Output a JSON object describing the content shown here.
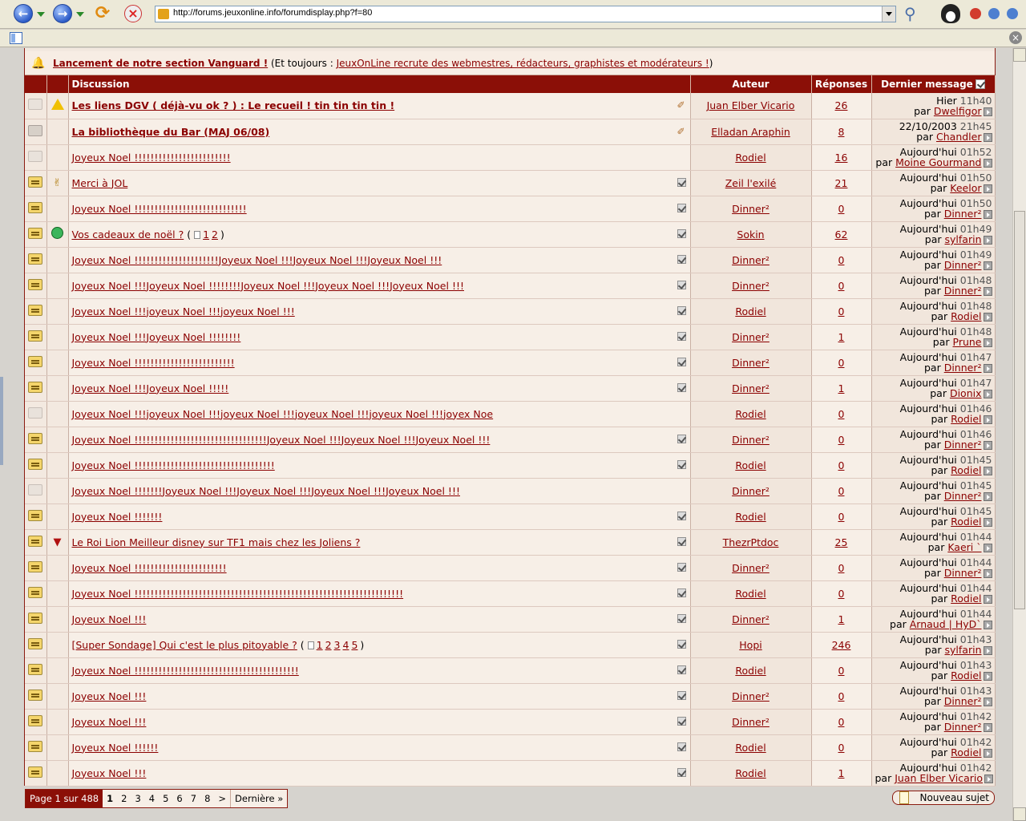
{
  "browser": {
    "url": "http://forums.jeuxonline.info/forumdisplay.php?f=80"
  },
  "announcement": {
    "title": "Lancement de notre section Vanguard !",
    "middle": "(Et toujours : ",
    "link": "JeuxOnLine recrute des webmestres, rédacteurs, graphistes et modérateurs !",
    "end": ")"
  },
  "headers": {
    "discussion": "Discussion",
    "author": "Auteur",
    "replies": "Réponses",
    "last": "Dernier message"
  },
  "threads": [
    {
      "status": "old",
      "icon": "warning-icon",
      "title": "Les liens DGV ( déjà-vu ok ? ) : Le recueil ! tin tin tin tin !",
      "bold": true,
      "mark": "pin",
      "author": "Juan Elber Vicario",
      "replies": "26",
      "last_day": "Hier",
      "last_time": "11h40",
      "last_by": "Dwelfigor"
    },
    {
      "status": "lock",
      "icon": "",
      "title": "La bibliothèque du Bar (MAJ 06/08)",
      "bold": true,
      "mark": "pin",
      "author": "Elladan Araphin",
      "replies": "8",
      "last_day": "22/10/2003",
      "last_time": "21h45",
      "last_by": "Chandler"
    },
    {
      "status": "old",
      "icon": "",
      "title": "Joyeux Noel !!!!!!!!!!!!!!!!!!!!!!!!",
      "bold": false,
      "mark": "",
      "author": "Rodiel",
      "replies": "16",
      "last_day": "Aujourd'hui",
      "last_time": "01h52",
      "last_by": "Moine Gourmand"
    },
    {
      "status": "new",
      "icon": "thumbs-up-icon",
      "title": "Merci à JOL",
      "bold": false,
      "mark": "check",
      "author": "Zeil l'exilé",
      "replies": "21",
      "last_day": "Aujourd'hui",
      "last_time": "01h50",
      "last_by": "Keelor"
    },
    {
      "status": "new",
      "icon": "",
      "title": "Joyeux Noel !!!!!!!!!!!!!!!!!!!!!!!!!!!!",
      "bold": false,
      "mark": "check",
      "author": "Dinner²",
      "replies": "0",
      "last_day": "Aujourd'hui",
      "last_time": "01h50",
      "last_by": "Dinner²"
    },
    {
      "status": "new",
      "icon": "grin-icon",
      "title": "Vos cadeaux de noël ?",
      "pages": [
        "1",
        "2"
      ],
      "bold": false,
      "mark": "check",
      "author": "Sokin",
      "replies": "62",
      "last_day": "Aujourd'hui",
      "last_time": "01h49",
      "last_by": "sylfarin"
    },
    {
      "status": "new",
      "icon": "",
      "title": "Joyeux Noel !!!!!!!!!!!!!!!!!!!!!Joyeux Noel !!!Joyeux Noel !!!Joyeux Noel !!!",
      "bold": false,
      "mark": "check",
      "author": "Dinner²",
      "replies": "0",
      "last_day": "Aujourd'hui",
      "last_time": "01h49",
      "last_by": "Dinner²"
    },
    {
      "status": "new",
      "icon": "",
      "title": "Joyeux Noel !!!Joyeux Noel !!!!!!!!Joyeux Noel !!!Joyeux Noel !!!Joyeux Noel !!!",
      "bold": false,
      "mark": "check",
      "author": "Dinner²",
      "replies": "0",
      "last_day": "Aujourd'hui",
      "last_time": "01h48",
      "last_by": "Dinner²"
    },
    {
      "status": "new",
      "icon": "",
      "title": "Joyeux Noel !!!joyeux Noel !!!joyeux Noel !!!",
      "bold": false,
      "mark": "check",
      "author": "Rodiel",
      "replies": "0",
      "last_day": "Aujourd'hui",
      "last_time": "01h48",
      "last_by": "Rodiel"
    },
    {
      "status": "new",
      "icon": "",
      "title": "Joyeux Noel !!!Joyeux Noel !!!!!!!!",
      "bold": false,
      "mark": "check",
      "author": "Dinner²",
      "replies": "1",
      "last_day": "Aujourd'hui",
      "last_time": "01h48",
      "last_by": "Prune"
    },
    {
      "status": "new",
      "icon": "",
      "title": "Joyeux Noel !!!!!!!!!!!!!!!!!!!!!!!!!",
      "bold": false,
      "mark": "check",
      "author": "Dinner²",
      "replies": "0",
      "last_day": "Aujourd'hui",
      "last_time": "01h47",
      "last_by": "Dinner²"
    },
    {
      "status": "new",
      "icon": "",
      "title": "Joyeux Noel !!!Joyeux Noel !!!!!",
      "bold": false,
      "mark": "check",
      "author": "Dinner²",
      "replies": "1",
      "last_day": "Aujourd'hui",
      "last_time": "01h47",
      "last_by": "Dionix"
    },
    {
      "status": "old",
      "icon": "",
      "title": "Joyeux Noel !!!joyeux Noel !!!joyeux Noel !!!joyeux Noel !!!joyeux Noel !!!joyex Noe",
      "bold": false,
      "mark": "",
      "author": "Rodiel",
      "replies": "0",
      "last_day": "Aujourd'hui",
      "last_time": "01h46",
      "last_by": "Rodiel"
    },
    {
      "status": "new",
      "icon": "",
      "title": "Joyeux Noel !!!!!!!!!!!!!!!!!!!!!!!!!!!!!!!!!Joyeux Noel !!!Joyeux Noel !!!Joyeux Noel !!!",
      "bold": false,
      "mark": "check",
      "author": "Dinner²",
      "replies": "0",
      "last_day": "Aujourd'hui",
      "last_time": "01h46",
      "last_by": "Dinner²"
    },
    {
      "status": "new",
      "icon": "",
      "title": "Joyeux Noel !!!!!!!!!!!!!!!!!!!!!!!!!!!!!!!!!!!",
      "bold": false,
      "mark": "check",
      "author": "Rodiel",
      "replies": "0",
      "last_day": "Aujourd'hui",
      "last_time": "01h45",
      "last_by": "Rodiel"
    },
    {
      "status": "old",
      "icon": "",
      "title": "Joyeux Noel !!!!!!!Joyeux Noel !!!Joyeux Noel !!!Joyeux Noel !!!Joyeux Noel !!!",
      "bold": false,
      "mark": "",
      "author": "Dinner²",
      "replies": "0",
      "last_day": "Aujourd'hui",
      "last_time": "01h45",
      "last_by": "Dinner²"
    },
    {
      "status": "new",
      "icon": "",
      "title": "Joyeux Noel !!!!!!!",
      "bold": false,
      "mark": "check",
      "author": "Rodiel",
      "replies": "0",
      "last_day": "Aujourd'hui",
      "last_time": "01h45",
      "last_by": "Rodiel"
    },
    {
      "status": "new",
      "icon": "trophy-icon",
      "title": "Le Roi Lion Meilleur disney sur TF1 mais chez les Joliens ?",
      "bold": false,
      "mark": "check",
      "author": "ThezrPtdoc",
      "replies": "25",
      "last_day": "Aujourd'hui",
      "last_time": "01h44",
      "last_by": "Kaeri `"
    },
    {
      "status": "new",
      "icon": "",
      "title": "Joyeux Noel !!!!!!!!!!!!!!!!!!!!!!!",
      "bold": false,
      "mark": "check",
      "author": "Dinner²",
      "replies": "0",
      "last_day": "Aujourd'hui",
      "last_time": "01h44",
      "last_by": "Dinner²"
    },
    {
      "status": "new",
      "icon": "",
      "title": "Joyeux Noel !!!!!!!!!!!!!!!!!!!!!!!!!!!!!!!!!!!!!!!!!!!!!!!!!!!!!!!!!!!!!!!!!!!",
      "bold": false,
      "mark": "check",
      "author": "Rodiel",
      "replies": "0",
      "last_day": "Aujourd'hui",
      "last_time": "01h44",
      "last_by": "Rodiel"
    },
    {
      "status": "new",
      "icon": "",
      "title": "Joyeux Noel !!!",
      "bold": false,
      "mark": "check",
      "author": "Dinner²",
      "replies": "1",
      "last_day": "Aujourd'hui",
      "last_time": "01h44",
      "last_by": "Arnaud | HyD`"
    },
    {
      "status": "new",
      "icon": "",
      "title": "[Super Sondage] Qui c'est le plus pitoyable ?",
      "pages": [
        "1",
        "2",
        "3",
        "4",
        "5"
      ],
      "bold": false,
      "mark": "check",
      "author": "Hopi",
      "replies": "246",
      "last_day": "Aujourd'hui",
      "last_time": "01h43",
      "last_by": "sylfarin"
    },
    {
      "status": "new",
      "icon": "",
      "title": "Joyeux Noel !!!!!!!!!!!!!!!!!!!!!!!!!!!!!!!!!!!!!!!!!",
      "bold": false,
      "mark": "check",
      "author": "Rodiel",
      "replies": "0",
      "last_day": "Aujourd'hui",
      "last_time": "01h43",
      "last_by": "Rodiel"
    },
    {
      "status": "new",
      "icon": "",
      "title": "Joyeux Noel !!!",
      "bold": false,
      "mark": "check",
      "author": "Dinner²",
      "replies": "0",
      "last_day": "Aujourd'hui",
      "last_time": "01h43",
      "last_by": "Dinner²"
    },
    {
      "status": "new",
      "icon": "",
      "title": "Joyeux Noel !!!",
      "bold": false,
      "mark": "check",
      "author": "Dinner²",
      "replies": "0",
      "last_day": "Aujourd'hui",
      "last_time": "01h42",
      "last_by": "Dinner²"
    },
    {
      "status": "new",
      "icon": "",
      "title": "Joyeux Noel !!!!!!",
      "bold": false,
      "mark": "check",
      "author": "Rodiel",
      "replies": "0",
      "last_day": "Aujourd'hui",
      "last_time": "01h42",
      "last_by": "Rodiel"
    },
    {
      "status": "new",
      "icon": "",
      "title": "Joyeux Noel !!!",
      "bold": false,
      "mark": "check",
      "author": "Rodiel",
      "replies": "1",
      "last_day": "Aujourd'hui",
      "last_time": "01h42",
      "last_by": "Juan Elber Vicario"
    }
  ],
  "by_prefix": "par",
  "pagination": {
    "label": "Page 1 sur 488",
    "pages": [
      "1",
      "2",
      "3",
      "4",
      "5",
      "6",
      "7",
      "8",
      ">"
    ],
    "current": "1",
    "last": "Dernière »"
  },
  "new_topic": "Nouveau sujet",
  "colors": {
    "header_bg": "#8b0f07",
    "link": "#8b0000",
    "row_bg": "#f7efe7"
  }
}
